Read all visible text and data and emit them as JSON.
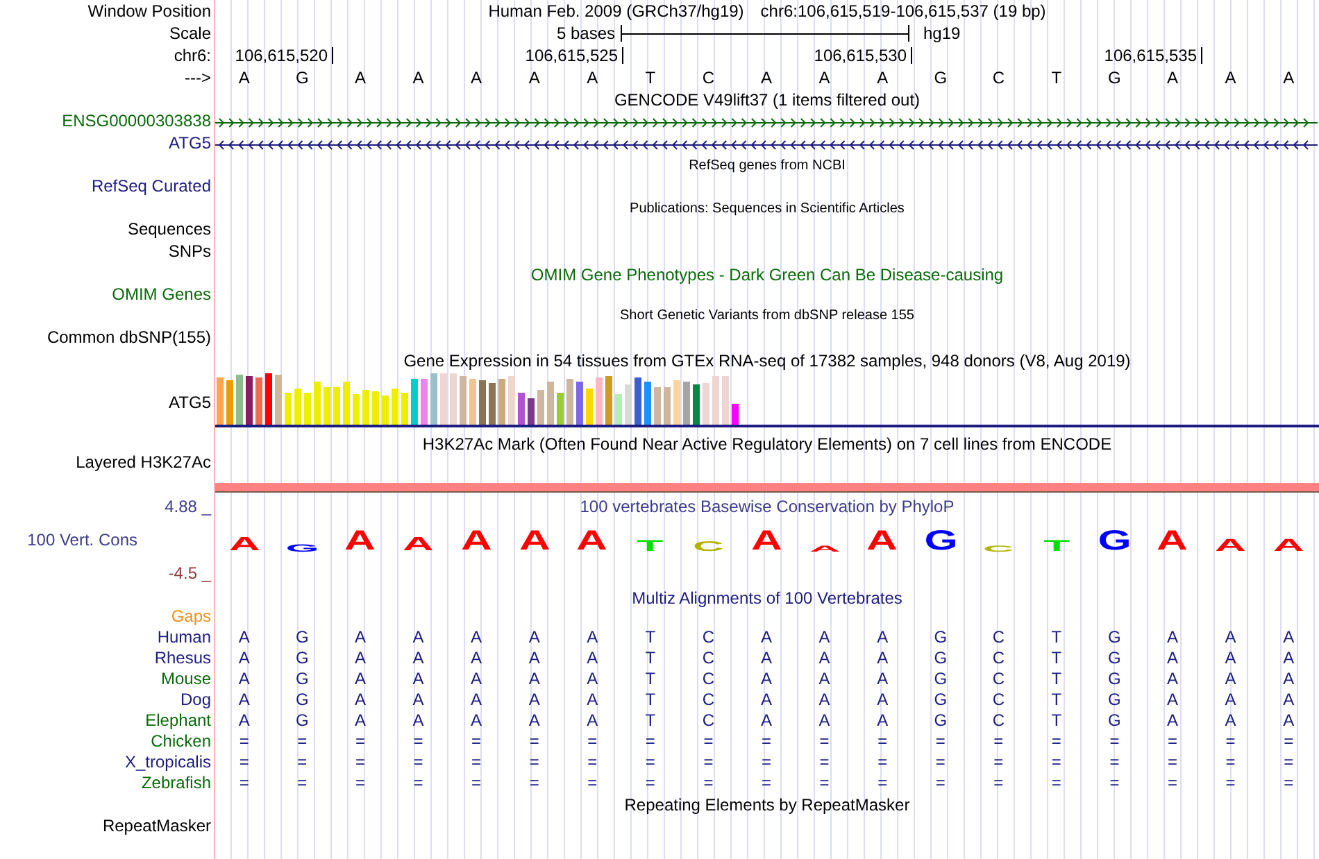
{
  "header": {
    "assembly": "Human Feb. 2009 (GRCh37/hg19)",
    "position": "chr6:106,615,519-106,615,537 (19 bp)"
  },
  "ruler": {
    "window_label": "Window Position",
    "scale_label": "Scale",
    "chrom_label": "chr6:",
    "strand_label": "--->",
    "scale_text": "5 bases",
    "scale_assembly": "hg19",
    "ticks": [
      "106,615,520",
      "106,615,525",
      "106,615,530",
      "106,615,535"
    ],
    "bases": [
      "A",
      "G",
      "A",
      "A",
      "A",
      "A",
      "A",
      "T",
      "C",
      "A",
      "A",
      "A",
      "G",
      "C",
      "T",
      "G",
      "A",
      "A",
      "A"
    ]
  },
  "gencode": {
    "title": "GENCODE V49lift37 (1 items filtered out)",
    "genes": [
      {
        "name": "ENSG00000303838",
        "color": "#0a6a0a",
        "reverse": false
      },
      {
        "name": "ATG5",
        "color": "#1c1c80",
        "reverse": true
      }
    ]
  },
  "refseq": {
    "label": "RefSeq Curated",
    "title": "RefSeq genes from NCBI"
  },
  "publications": {
    "labels": [
      "Sequences",
      "SNPs"
    ],
    "title": "Publications: Sequences in Scientific Articles"
  },
  "omim": {
    "label": "OMIM Genes",
    "title": "OMIM Gene Phenotypes - Dark Green Can Be Disease-causing"
  },
  "dbsnp": {
    "label": "Common dbSNP(155)",
    "title": "Short Genetic Variants from dbSNP release 155"
  },
  "gtex": {
    "label": "ATG5",
    "title": "Gene Expression in 54 tissues from GTEx RNA-seq of 17382 samples, 948 donors (V8, Aug 2019)"
  },
  "h3k27ac": {
    "label": "Layered H3K27Ac",
    "title": "H3K27Ac Mark (Often Found Near Active Regulatory Elements) on 7 cell lines from ENCODE"
  },
  "conservation": {
    "label": "100 Vert. Cons",
    "max": "4.88 _",
    "min": "-4.5 _",
    "title": "100 vertebrates Basewise Conservation by PhyloP",
    "logo": [
      {
        "base": "A",
        "color": "#ff0000"
      },
      {
        "base": "G",
        "color": "#0000ff"
      },
      {
        "base": "A",
        "color": "#ff0000"
      },
      {
        "base": "A",
        "color": "#ff0000"
      },
      {
        "base": "A",
        "color": "#ff0000"
      },
      {
        "base": "A",
        "color": "#ff0000"
      },
      {
        "base": "A",
        "color": "#ff0000"
      },
      {
        "base": "T",
        "color": "#00e000"
      },
      {
        "base": "C",
        "color": "#b4b400"
      },
      {
        "base": "A",
        "color": "#ff0000"
      },
      {
        "base": "A",
        "color": "#ff0000"
      },
      {
        "base": "A",
        "color": "#ff0000"
      },
      {
        "base": "G",
        "color": "#0000ff"
      },
      {
        "base": "C",
        "color": "#b4b400"
      },
      {
        "base": "T",
        "color": "#00e000"
      },
      {
        "base": "G",
        "color": "#0000ff"
      },
      {
        "base": "A",
        "color": "#ff0000"
      },
      {
        "base": "A",
        "color": "#ff0000"
      },
      {
        "base": "A",
        "color": "#ff0000"
      }
    ]
  },
  "multiz": {
    "title": "Multiz Alignments of 100 Vertebrates",
    "gaps_label": "Gaps",
    "species": [
      {
        "name": "Human",
        "color": "#1c1c80",
        "bases": [
          "A",
          "G",
          "A",
          "A",
          "A",
          "A",
          "A",
          "T",
          "C",
          "A",
          "A",
          "A",
          "G",
          "C",
          "T",
          "G",
          "A",
          "A",
          "A"
        ]
      },
      {
        "name": "Rhesus",
        "color": "#1c1c80",
        "bases": [
          "A",
          "G",
          "A",
          "A",
          "A",
          "A",
          "A",
          "T",
          "C",
          "A",
          "A",
          "A",
          "G",
          "C",
          "T",
          "G",
          "A",
          "A",
          "A"
        ]
      },
      {
        "name": "Mouse",
        "color": "#0a6a0a",
        "bases": [
          "A",
          "G",
          "A",
          "A",
          "A",
          "A",
          "A",
          "T",
          "C",
          "A",
          "A",
          "A",
          "G",
          "C",
          "T",
          "G",
          "A",
          "A",
          "A"
        ]
      },
      {
        "name": "Dog",
        "color": "#1c1c80",
        "bases": [
          "A",
          "G",
          "A",
          "A",
          "A",
          "A",
          "A",
          "T",
          "C",
          "A",
          "A",
          "A",
          "G",
          "C",
          "T",
          "G",
          "A",
          "A",
          "A"
        ]
      },
      {
        "name": "Elephant",
        "color": "#0a6a0a",
        "bases": [
          "A",
          "G",
          "A",
          "A",
          "A",
          "A",
          "A",
          "T",
          "C",
          "A",
          "A",
          "A",
          "G",
          "C",
          "T",
          "G",
          "A",
          "A",
          "A"
        ]
      },
      {
        "name": "Chicken",
        "color": "#0a6a0a",
        "bases": [
          "=",
          "=",
          "=",
          "=",
          "=",
          "=",
          "=",
          "=",
          "=",
          "=",
          "=",
          "=",
          "=",
          "=",
          "=",
          "=",
          "=",
          "=",
          "="
        ]
      },
      {
        "name": "X_tropicalis",
        "color": "#1c1c80",
        "bases": [
          "=",
          "=",
          "=",
          "=",
          "=",
          "=",
          "=",
          "=",
          "=",
          "=",
          "=",
          "=",
          "=",
          "=",
          "=",
          "=",
          "=",
          "=",
          "="
        ]
      },
      {
        "name": "Zebrafish",
        "color": "#0a6a0a",
        "bases": [
          "=",
          "=",
          "=",
          "=",
          "=",
          "=",
          "=",
          "=",
          "=",
          "=",
          "=",
          "=",
          "=",
          "=",
          "=",
          "=",
          "=",
          "=",
          "="
        ]
      }
    ]
  },
  "repeatmasker": {
    "label": "RepeatMasker",
    "title": "Repeating Elements by RepeatMasker"
  }
}
